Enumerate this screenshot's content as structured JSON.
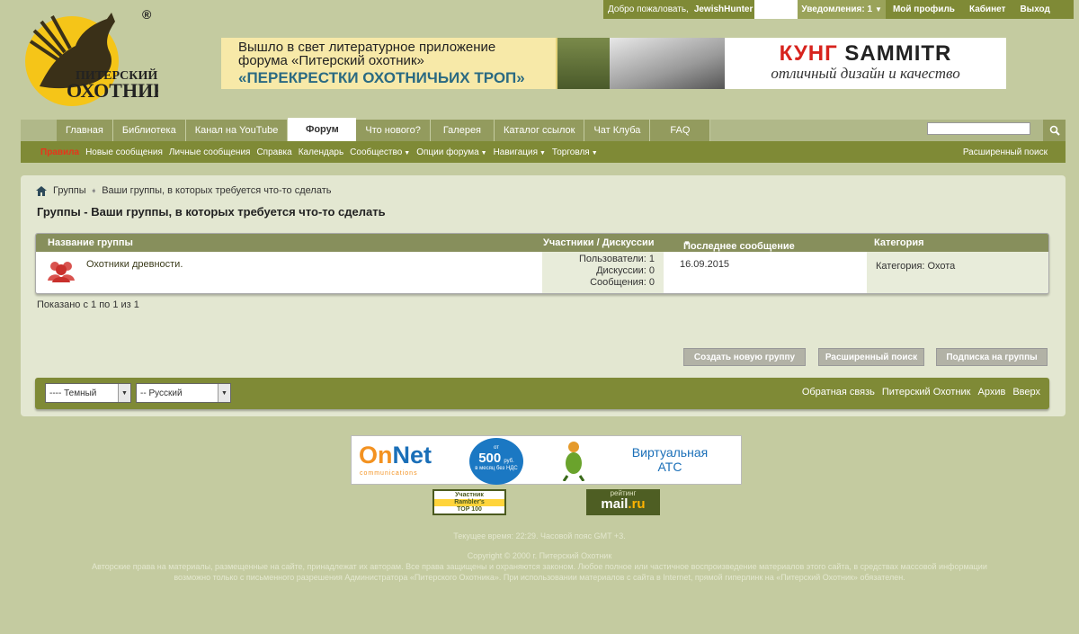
{
  "userbar": {
    "welcome": "Добро пожаловать,",
    "username": "JewishHunter",
    "notifications": "Уведомления: 1",
    "links": [
      "Мой профиль",
      "Кабинет",
      "Выход"
    ]
  },
  "logo": {
    "line1": "ПИТЕРСКИЙ",
    "line2": "ОХОТНИК",
    "registered": "®"
  },
  "banner": {
    "line1": "Вышло в свет литературное приложение",
    "line2": "форума «Питерский охотник»",
    "line3": "«ПЕРЕКРЕСТКИ ОХОТНИЧЬИХ ТРОП»",
    "brand_red": "КУНГ",
    "brand_black": "SAMMITR",
    "slogan": "отличный дизайн и качество"
  },
  "nav": {
    "tabs": [
      "Главная",
      "Библиотека",
      "Канал на YouTube",
      "Форум",
      "Что нового?",
      "Галерея",
      "Каталог ссылок",
      "Чат Клуба",
      "FAQ"
    ],
    "active": "Форум"
  },
  "subnav": {
    "items": [
      {
        "label": "Правила"
      },
      {
        "label": "Новые сообщения"
      },
      {
        "label": "Личные сообщения"
      },
      {
        "label": "Справка"
      },
      {
        "label": "Календарь"
      },
      {
        "label": "Сообщество"
      },
      {
        "label": "Опции форума"
      },
      {
        "label": "Навигация"
      },
      {
        "label": "Торговля"
      }
    ],
    "advanced_search": "Расширенный поиск"
  },
  "breadcrumb": {
    "root": "Группы",
    "current": "Ваши группы, в которых требуется что-то сделать"
  },
  "page_title": "Группы - Ваши группы, в которых требуется что-то сделать",
  "table": {
    "headers": {
      "name": "Название группы",
      "members": "Участники / Дискуссии",
      "last_post": "Последнее сообщение",
      "category": "Категория"
    },
    "rows": [
      {
        "name": "Охотники древности.",
        "users": "Пользователи: 1",
        "discussions": "Дискуссии: 0",
        "messages": "Сообщения: 0",
        "date": "16.09.2015",
        "category": "Категория: Охота"
      }
    ]
  },
  "shown": "Показано с 1 по 1 из 1",
  "buttons": {
    "create": "Создать новую группу",
    "advanced": "Расширенный поиск",
    "subscribe": "Подписка на группы"
  },
  "footer": {
    "style_select": "---- Темный",
    "lang_select": "-- Русский",
    "links": [
      "Обратная связь",
      "Питерский Охотник",
      "Архив",
      "Вверх"
    ]
  },
  "ads": {
    "onnet_on": "On",
    "onnet_net": "Net",
    "onnet_sub": "communications",
    "price_prefix": "от",
    "price": "500",
    "price_unit": "руб.",
    "price_note": "в месяц без НДС",
    "atc": "Виртуальная АТС"
  },
  "counters": {
    "rambler": {
      "l1": "Участник",
      "l2": "Rambler's",
      "l3": "TOP 100"
    },
    "mailru": {
      "l1": "рейтинг",
      "mail": "mail",
      "ru": ".ru"
    }
  },
  "bottom": {
    "time": "Текущее время: 22:29. Часовой пояс GMT +3.",
    "copyright": "Copyright © 2000 г. Питерский Охотник",
    "rights1": "Авторские права на материалы, размещенные на сайте, принадлежат их авторам. Все права защищены и охраняются законом. Любое полное или частичное воспроизведение материалов этого сайта, в средствах массовой информации",
    "rights2": "возможно только с письменного разрешения Администратора «Питерского Охотника». При использовании материалов с сайта в Internet, прямой гиперлинк на «Питерский Охотник» обязателен."
  },
  "colors": {
    "accent": "#7f8a36",
    "tab": "#939b5e",
    "rules": "#e7351b",
    "page": "#c4cba0"
  }
}
